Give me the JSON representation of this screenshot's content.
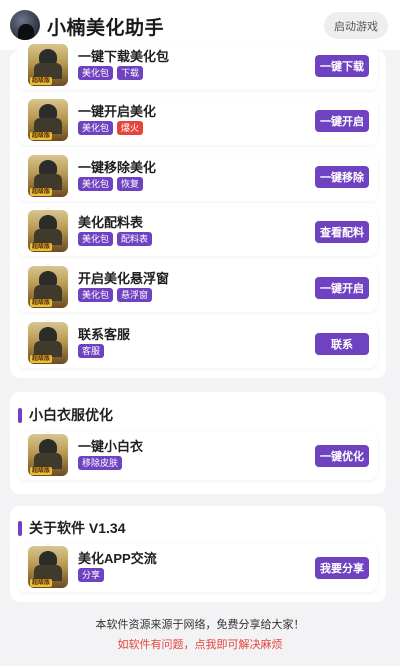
{
  "header": {
    "title": "小楠美化助手",
    "launch_label": "启动游戏",
    "avatar_icon": "user-avatar-icon"
  },
  "accent_color": "#6f42c1",
  "chip_hot_color": "#e5443b",
  "thumbnail_badge": "超级版",
  "section_main": {
    "items": [
      {
        "title": "一键下载美化包",
        "chips": [
          "美化包",
          "下载"
        ],
        "button": "一键下载"
      },
      {
        "title": "一键开启美化",
        "chips": [
          "美化包",
          "爆火"
        ],
        "hot_chip": 1,
        "button": "一键开启"
      },
      {
        "title": "一键移除美化",
        "chips": [
          "美化包",
          "恢复"
        ],
        "button": "一键移除"
      },
      {
        "title": "美化配料表",
        "chips": [
          "美化包",
          "配料表"
        ],
        "button": "查看配料"
      },
      {
        "title": "开启美化悬浮窗",
        "chips": [
          "美化包",
          "悬浮窗"
        ],
        "button": "一键开启"
      },
      {
        "title": "联系客服",
        "chips": [
          "客服"
        ],
        "button": "联系"
      }
    ]
  },
  "section_clothes": {
    "title": "小白衣服优化",
    "items": [
      {
        "title": "一键小白衣",
        "chips": [
          "移除皮肤"
        ],
        "button": "一键优化"
      }
    ]
  },
  "section_about": {
    "title": "关于软件 V1.34",
    "items": [
      {
        "title": "美化APP交流",
        "chips": [
          "分享"
        ],
        "button": "我要分享"
      }
    ]
  },
  "footer": {
    "line1": "本软件资源来源于网络，免费分享给大家！",
    "line2": "如软件有问题，点我即可解决麻烦"
  }
}
